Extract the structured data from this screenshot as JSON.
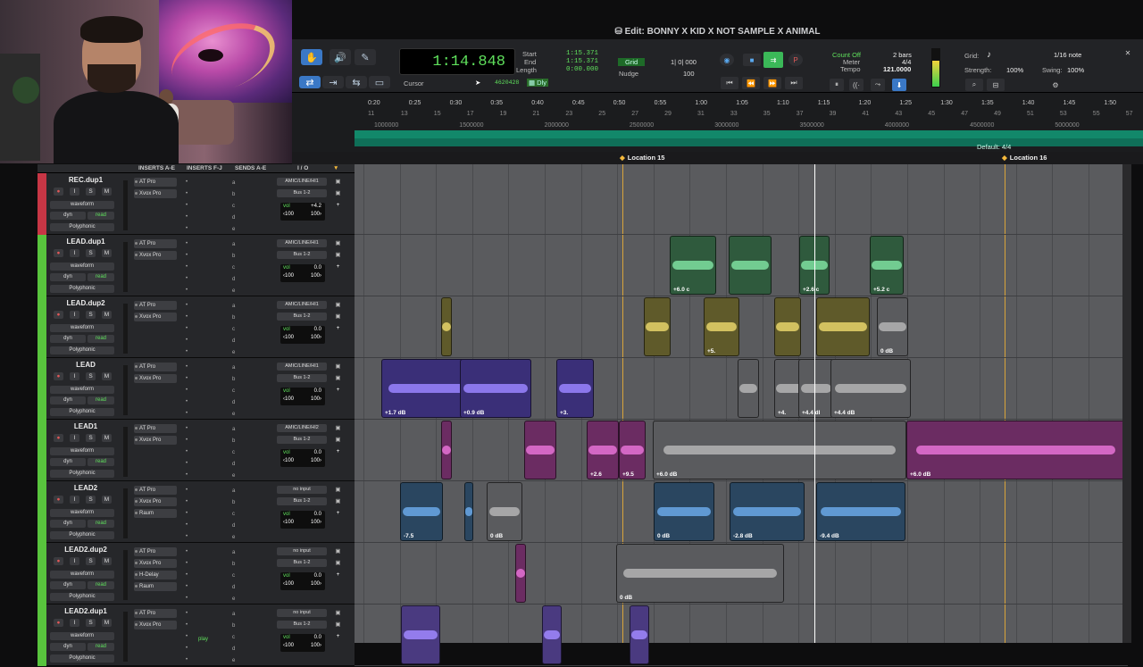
{
  "window": {
    "title": "Edit: BONNY X KID X NOT SAMPLE X ANIMAL"
  },
  "toolbar": {
    "main_counter": "1:14.848",
    "start_label": "Start",
    "start_value": "1:15.371",
    "end_label": "End",
    "end_value": "1:15.371",
    "length_label": "Length",
    "length_value": "0:00.000",
    "cursor_label": "Cursor",
    "cursor_value": "4620428",
    "dly_label": "Dly",
    "grid_label": "Grid",
    "grid_value": "1| 0| 000",
    "nudge_label": "Nudge",
    "nudge_value": "100",
    "count_off": "Count Off",
    "meter_label": "Meter",
    "tempo_label": "Tempo",
    "bars": "2 bars",
    "meter_value": "4/4",
    "tempo_value": "121.0000",
    "grid_r_label": "Grid:",
    "grid_note": "1/16 note",
    "strength_label": "Strength:",
    "strength_value": "100%",
    "swing_label": "Swing:",
    "swing_value": "100%"
  },
  "ruler": {
    "minsecs": [
      "0:20",
      "0:25",
      "0:30",
      "0:35",
      "0:40",
      "0:45",
      "0:50",
      "0:55",
      "1:00",
      "1:05",
      "1:10",
      "1:15",
      "1:20",
      "1:25",
      "1:30",
      "1:35",
      "1:40",
      "1:45",
      "1:50"
    ],
    "bars": [
      "11",
      "13",
      "15",
      "17",
      "19",
      "21",
      "23",
      "25",
      "27",
      "29",
      "31",
      "33",
      "35",
      "37",
      "39",
      "41",
      "43",
      "45",
      "47",
      "49",
      "51",
      "53",
      "55",
      "57"
    ],
    "samples": [
      "1000000",
      "1500000",
      "2000000",
      "2500000",
      "3000000",
      "3500000",
      "4000000",
      "4500000",
      "5000000"
    ],
    "tempo_meter": "Default: 4/4"
  },
  "markers": {
    "loc15": "Location 15",
    "loc16": "Location 16"
  },
  "mix_header": {
    "inserts_ae": "INSERTS A-E",
    "inserts_fj": "INSERTS F-J",
    "sends_ae": "SENDS A-E",
    "io": "I / O"
  },
  "common": {
    "waveform": "waveform",
    "dyn": "dyn",
    "read": "read",
    "polyphonic": "Polyphonic",
    "vol": "vol",
    "pan_l": "‹100",
    "pan_r": "100›",
    "bus": "Bus 1-2",
    "I": "I",
    "S": "S",
    "M": "M"
  },
  "tracks": [
    {
      "name": "REC.dup1",
      "color": "#c73645",
      "inserts": [
        "AT Pro",
        "Xvox Pro"
      ],
      "input": "AMIC/LINE/HI1",
      "vol": "+4.2"
    },
    {
      "name": "LEAD.dup1",
      "color": "#58c43d",
      "inserts": [
        "AT Pro",
        "Xvox Pro"
      ],
      "input": "AMIC/LINE/HI1",
      "vol": "0.0"
    },
    {
      "name": "LEAD.dup2",
      "color": "#58c43d",
      "inserts": [
        "AT Pro",
        "Xvox Pro"
      ],
      "input": "AMIC/LINE/HI1",
      "vol": "0.0"
    },
    {
      "name": "LEAD",
      "color": "#58c43d",
      "inserts": [
        "AT Pro",
        "Xvox Pro"
      ],
      "input": "AMIC/LINE/HI1",
      "vol": "0.0"
    },
    {
      "name": "LEAD1",
      "color": "#58c43d",
      "inserts": [
        "AT Pro",
        "Xvox Pro"
      ],
      "input": "AMIC/LINE/HI2",
      "vol": "0.0"
    },
    {
      "name": "LEAD2",
      "color": "#58c43d",
      "inserts": [
        "AT Pro",
        "Xvox Pro",
        "Raum"
      ],
      "input": "no input",
      "vol": "0.0"
    },
    {
      "name": "LEAD2.dup2",
      "color": "#58c43d",
      "inserts": [
        "AT Pro",
        "Xvox Pro",
        "H-Delay",
        "Raum"
      ],
      "input": "no input",
      "vol": "0.0"
    },
    {
      "name": "LEAD2.dup1",
      "color": "#58c43d",
      "inserts": [
        "AT Pro",
        "Xvox Pro"
      ],
      "input": "no input",
      "vol": "0.0"
    }
  ],
  "clips": {
    "lead_dup1": [
      "+6.0 c",
      "+2.6 c",
      "+5.2 c"
    ],
    "lead_dup2": [
      "+5.",
      "0 dB"
    ],
    "lead": [
      "+1.7 dB",
      "+0.9 dB",
      "+3.",
      "+4.",
      "+4.4 dl",
      "+4.4 dB"
    ],
    "lead1": [
      "+2.6",
      "+9.5",
      "+6.0 dB",
      "+6.0 dB"
    ],
    "lead2": [
      "-7.5",
      "0 dB",
      "0 dB",
      "-2.8 dB",
      "-9.4 dB"
    ],
    "lead2_dup2": [
      "0 dB"
    ]
  },
  "footer": {
    "play": "play"
  },
  "colors": {
    "green": "#5fe05c",
    "accent_blue": "#3a78c6",
    "location": "#d9a43a"
  }
}
